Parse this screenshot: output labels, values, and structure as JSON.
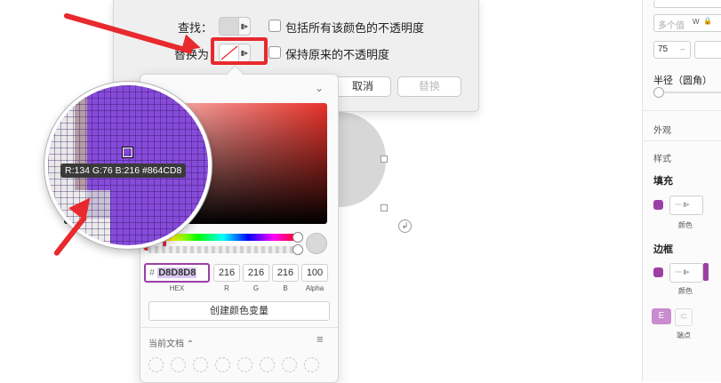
{
  "dialog": {
    "find_label": "查找：",
    "replace_label": "替换为",
    "include_opacity": "包括所有该颜色的不透明度",
    "keep_opacity": "保持原来的不透明度",
    "cancel": "取消",
    "replace": "替换"
  },
  "magnifier": {
    "readout": "R:134 G:76 B:216 #864CD8",
    "color": "#864CD8"
  },
  "picker": {
    "hex_prefix": "#",
    "hex": "D8D8D8",
    "r": "216",
    "g": "216",
    "b": "216",
    "alpha": "100",
    "hex_caption": "HEX",
    "r_caption": "R",
    "g_caption": "G",
    "b_caption": "B",
    "alpha_caption": "Alpha",
    "create_variable": "创建颜色变量",
    "current_document": "当前文档 ⌃",
    "menu_icon": "≡",
    "chevron": "⌄"
  },
  "inspector": {
    "multi_value": "多个值",
    "w_label": "W",
    "lock_icon": "🔒",
    "value_75": "75",
    "radius_label": "半径（圆角）",
    "appearance": "外观",
    "style": "样式",
    "fill": "填充",
    "fill_caption": "颜色",
    "border": "边框",
    "border_caption": "颜色",
    "endpoint": "端点"
  },
  "colors": {
    "accent_red": "#E8292D",
    "purple": "#864CD8",
    "checkbox_purple": "#9B3FA6",
    "swatch_gray": "#D8D8D8"
  }
}
